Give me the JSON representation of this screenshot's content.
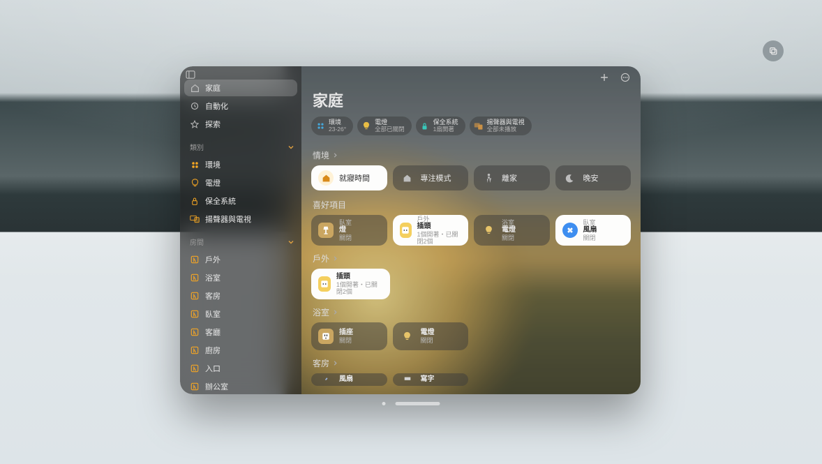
{
  "sidebar": {
    "primary": [
      {
        "icon": "house",
        "label": "家庭",
        "active": true
      },
      {
        "icon": "clock",
        "label": "自動化"
      },
      {
        "icon": "star",
        "label": "探索"
      }
    ],
    "categories_header": "類別",
    "categories": [
      {
        "icon": "climate",
        "label": "環境",
        "color": "orange"
      },
      {
        "icon": "bulb",
        "label": "電燈",
        "color": "orange"
      },
      {
        "icon": "lock",
        "label": "保全系統",
        "color": "orange"
      },
      {
        "icon": "tv",
        "label": "揚聲器與電視",
        "color": "orange"
      }
    ],
    "rooms_header": "房間",
    "rooms": [
      {
        "label": "戶外"
      },
      {
        "label": "浴室"
      },
      {
        "label": "客房"
      },
      {
        "label": "臥室"
      },
      {
        "label": "客廳"
      },
      {
        "label": "廚房"
      },
      {
        "label": "入口"
      },
      {
        "label": "辦公室"
      }
    ]
  },
  "page_title": "家庭",
  "status_chips": [
    {
      "icon": "climate",
      "color": "#49b3ea",
      "l1": "環境",
      "l2": "23-26°"
    },
    {
      "icon": "bulb",
      "color": "#f7c948",
      "l1": "電燈",
      "l2": "全部已關閉"
    },
    {
      "icon": "lock",
      "color": "#3bd4c5",
      "l1": "保全系統",
      "l2": "1扇開著"
    },
    {
      "icon": "tv",
      "color": "#d79a4a",
      "l1": "揚聲器與電視",
      "l2": "全部未播放"
    }
  ],
  "sections": {
    "scenes": {
      "header": "情境",
      "items": [
        {
          "icon": "house",
          "label": "就寢時間",
          "on": true
        },
        {
          "icon": "focus",
          "label": "專注模式"
        },
        {
          "icon": "leave",
          "label": "離家"
        },
        {
          "icon": "moon",
          "label": "晚安"
        }
      ]
    },
    "favorites": {
      "header": "喜好項目",
      "items": [
        {
          "icon": "lamp",
          "room": "臥室",
          "name": "燈",
          "state": "關閉",
          "style": "dark",
          "icon_bg": "#d0a24a"
        },
        {
          "icon": "plug",
          "room": "戶外",
          "name": "插頭",
          "state": "1個開著・已關閉2個",
          "style": "light",
          "icon_bg": "#f4cf5e"
        },
        {
          "icon": "bulb",
          "room": "浴室",
          "name": "電燈",
          "state": "關閉",
          "style": "dark",
          "icon_bg": "#d0a24a"
        },
        {
          "icon": "fan",
          "room": "臥室",
          "name": "風扇",
          "state": "關閉",
          "style": "light",
          "icon_bg": "#3e8ef0"
        }
      ]
    },
    "outdoor": {
      "header": "戶外",
      "items": [
        {
          "icon": "plug",
          "name": "插頭",
          "state": "1個開著・已關閉2個",
          "style": "light",
          "icon_bg": "#f4cf5e"
        }
      ]
    },
    "bathroom": {
      "header": "浴室",
      "items": [
        {
          "icon": "plug",
          "name": "插座",
          "state": "關閉",
          "style": "dark",
          "icon_bg": "#d0a24a"
        },
        {
          "icon": "bulb",
          "name": "電燈",
          "state": "關閉",
          "style": "dark",
          "icon_bg": "#d0a24a"
        }
      ]
    },
    "guest": {
      "header": "客房",
      "items": [
        {
          "icon": "fan",
          "name": "風扇",
          "state": "",
          "style": "dark"
        },
        {
          "icon": "desk",
          "name": "寫字",
          "state": "",
          "style": "dark"
        }
      ]
    }
  },
  "colors": {
    "orange": "#f5a623"
  }
}
